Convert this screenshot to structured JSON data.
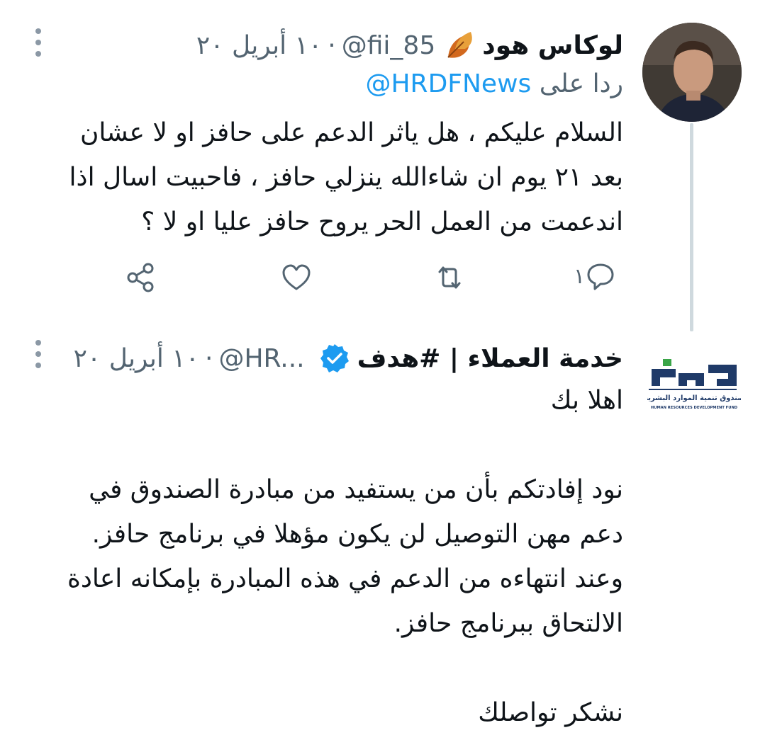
{
  "tweets": [
    {
      "display_name": "لوكاس هود",
      "handle": "@fii_85",
      "separator": "·",
      "date": "١٠ أبريل ٢٠",
      "reply_prefix": "ردا على",
      "reply_mention": "@HRDFNews",
      "text_lines": [
        "السلام عليكم ، هل ياثر الدعم على حافز او لا عشان",
        "بعد ٢١ يوم ان شاءالله ينزلي حافز ، فاحبيت اسال اذا",
        "اندعمت من العمل الحر يروح حافز عليا او لا ؟"
      ],
      "actions": {
        "reply_count": "١",
        "icons": [
          "reply-icon",
          "retweet-icon",
          "like-icon",
          "share-icon"
        ]
      }
    },
    {
      "display_name": "خدمة العملاء | #هدف",
      "handle": "@HR...",
      "separator": "·",
      "date": "١٠ أبريل ٢٠",
      "verified": true,
      "text_lines": [
        "اهلا بك",
        "",
        "نود إفادتكم بأن من يستفيد من مبادرة الصندوق في",
        "دعم مهن التوصيل لن يكون مؤهلا في برنامج حافز.",
        "وعند انتهاءه من الدعم في هذه المبادرة بإمكانه اعادة",
        "الالتحاق ببرنامج حافز.",
        "",
        "نشكر تواصلك"
      ]
    }
  ],
  "logo": {
    "arabic": "صندوق تنمية الموارد البشرية",
    "english": "HUMAN RESOURCES DEVELOPMENT FUND"
  },
  "colors": {
    "link": "#1d9bf0",
    "secondary_text": "#536471",
    "verified": "#1d9bf0",
    "logo_navy": "#1f3a68",
    "logo_green": "#3aa548",
    "thread_line": "#cfd9de"
  }
}
